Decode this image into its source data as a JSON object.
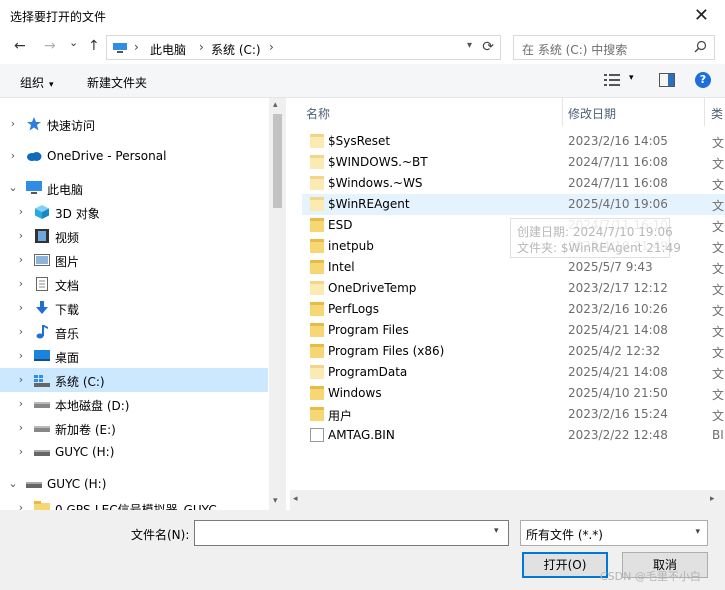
{
  "window": {
    "title": "选择要打开的文件",
    "close_glyph": "✕"
  },
  "nav": {
    "back": "←",
    "forward": "→",
    "recent": "⌄",
    "up": "↑",
    "breadcrumb": [
      "此电脑",
      "系统 (C:)"
    ],
    "separator": "›",
    "refresh": "⟳",
    "search_placeholder": "在 系统 (C:) 中搜索"
  },
  "toolbar": {
    "organize": "组织",
    "new_folder": "新建文件夹",
    "caret": "▾"
  },
  "tree": {
    "expand": "›",
    "collapse": "⌄",
    "items": [
      {
        "label": "快速访问",
        "icon": "star-icon",
        "depth": 0,
        "chevron": "›"
      },
      {
        "label": "OneDrive - Personal",
        "icon": "cloud-icon",
        "depth": 0,
        "chevron": "›"
      },
      {
        "label": "此电脑",
        "icon": "computer-icon",
        "depth": 0,
        "chevron": "⌄"
      },
      {
        "label": "3D 对象",
        "icon": "cube-icon",
        "depth": 1,
        "chevron": "›"
      },
      {
        "label": "视频",
        "icon": "video-icon",
        "depth": 1,
        "chevron": "›"
      },
      {
        "label": "图片",
        "icon": "picture-icon",
        "depth": 1,
        "chevron": "›"
      },
      {
        "label": "文档",
        "icon": "document-icon",
        "depth": 1,
        "chevron": "›"
      },
      {
        "label": "下载",
        "icon": "download-icon",
        "depth": 1,
        "chevron": "›"
      },
      {
        "label": "音乐",
        "icon": "music-icon",
        "depth": 1,
        "chevron": "›"
      },
      {
        "label": "桌面",
        "icon": "desktop-icon",
        "depth": 1,
        "chevron": "›"
      },
      {
        "label": "系统 (C:)",
        "icon": "system-drive-icon",
        "depth": 1,
        "chevron": "›",
        "selected": true
      },
      {
        "label": "本地磁盘 (D:)",
        "icon": "drive-icon",
        "depth": 1,
        "chevron": "›"
      },
      {
        "label": "新加卷 (E:)",
        "icon": "drive-icon",
        "depth": 1,
        "chevron": "›"
      },
      {
        "label": "GUYC (H:)",
        "icon": "usb-drive-icon",
        "depth": 1,
        "chevron": "›"
      },
      {
        "label": "GUYC (H:)",
        "icon": "usb-drive-icon",
        "depth": 0,
        "chevron": "⌄"
      },
      {
        "label": "0.GPS-LEC信号模拟器_GUYC",
        "icon": "folder-icon",
        "depth": 1,
        "chevron": "›"
      }
    ]
  },
  "list": {
    "columns": {
      "name": "名称",
      "modified": "修改日期",
      "type": "类"
    },
    "sort_caret": "^",
    "rows": [
      {
        "name": "$SysReset",
        "date": "2023/2/16 14:05",
        "type": "文",
        "kind": "folder-dim"
      },
      {
        "name": "$WINDOWS.~BT",
        "date": "2024/7/11 16:08",
        "type": "文",
        "kind": "folder-dim"
      },
      {
        "name": "$Windows.~WS",
        "date": "2024/7/11 16:08",
        "type": "文",
        "kind": "folder-dim"
      },
      {
        "name": "$WinREAgent",
        "date": "2025/4/10 19:06",
        "type": "文",
        "kind": "folder-dim",
        "hover": true
      },
      {
        "name": "ESD",
        "date": "2024/7/11 16:10",
        "type": "文",
        "kind": "folder"
      },
      {
        "name": "inetpub",
        "date": "2025/4/10 21:49",
        "type": "文",
        "kind": "folder"
      },
      {
        "name": "Intel",
        "date": "2025/5/7 9:43",
        "type": "文",
        "kind": "folder"
      },
      {
        "name": "OneDriveTemp",
        "date": "2023/2/17 12:12",
        "type": "文",
        "kind": "folder-dim"
      },
      {
        "name": "PerfLogs",
        "date": "2023/2/16 10:26",
        "type": "文",
        "kind": "folder"
      },
      {
        "name": "Program Files",
        "date": "2025/4/21 14:08",
        "type": "文",
        "kind": "folder"
      },
      {
        "name": "Program Files (x86)",
        "date": "2025/4/2 12:32",
        "type": "文",
        "kind": "folder"
      },
      {
        "name": "ProgramData",
        "date": "2025/4/21 14:08",
        "type": "文",
        "kind": "folder-dim"
      },
      {
        "name": "Windows",
        "date": "2025/4/10 21:50",
        "type": "文",
        "kind": "folder"
      },
      {
        "name": "用户",
        "date": "2023/2/16 15:24",
        "type": "文",
        "kind": "folder"
      },
      {
        "name": "AMTAG.BIN",
        "date": "2023/2/22 12:48",
        "type": "BI",
        "kind": "file"
      }
    ]
  },
  "tooltip": {
    "line1": "创建日期: 2024/7/10 19:06",
    "line2": "文件夹: $WinREAgent 21:49"
  },
  "scroll": {
    "up": "▴",
    "down": "▾",
    "left": "◂",
    "right": "▸"
  },
  "bottom": {
    "filename_label": "文件名(N):",
    "filename_value": "",
    "filename_caret": "▾",
    "filetype": "所有文件 (*.*)",
    "filetype_caret": "▾",
    "open_button": "打开(O)",
    "cancel_button": "取消"
  },
  "watermark": "CSDN @毛里不小白"
}
